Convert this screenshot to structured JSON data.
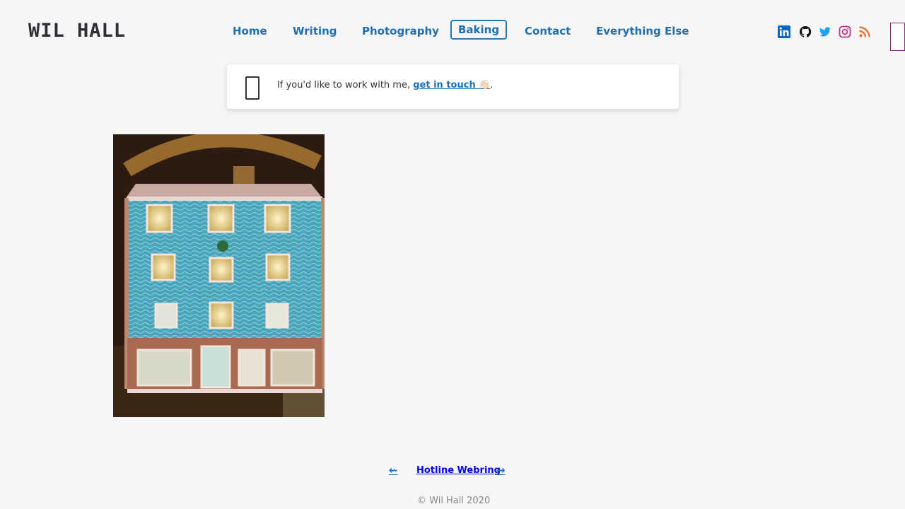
{
  "site": {
    "logo": "WIL HALL"
  },
  "nav": [
    {
      "label": "Home",
      "active": false
    },
    {
      "label": "Writing",
      "active": false
    },
    {
      "label": "Photography",
      "active": false
    },
    {
      "label": "Baking",
      "active": true
    },
    {
      "label": "Contact",
      "active": false
    },
    {
      "label": "Everything Else",
      "active": false
    }
  ],
  "social": [
    {
      "icon": "linkedin-icon",
      "color": "#0a66c2"
    },
    {
      "icon": "github-icon",
      "color": "#111111"
    },
    {
      "icon": "twitter-icon",
      "color": "#1da1f2"
    },
    {
      "icon": "instagram-icon",
      "color": "#c13584"
    },
    {
      "icon": "rss-icon",
      "color": "#f26522"
    }
  ],
  "notice": {
    "text_before": "If you'd like to work with me, ",
    "link_text": "get in touch 👋🏻",
    "text_after": "."
  },
  "gallery": {
    "image_alt": "Gingerbread house with blue icing walls and lit windows"
  },
  "webring": {
    "prev": "⇜",
    "label": "Hotline Webring",
    "next": "⇝"
  },
  "footer": {
    "copyright": "© Wil Hall 2020"
  },
  "colors": {
    "link": "#1f6fb0",
    "background": "#f6f6f6"
  }
}
